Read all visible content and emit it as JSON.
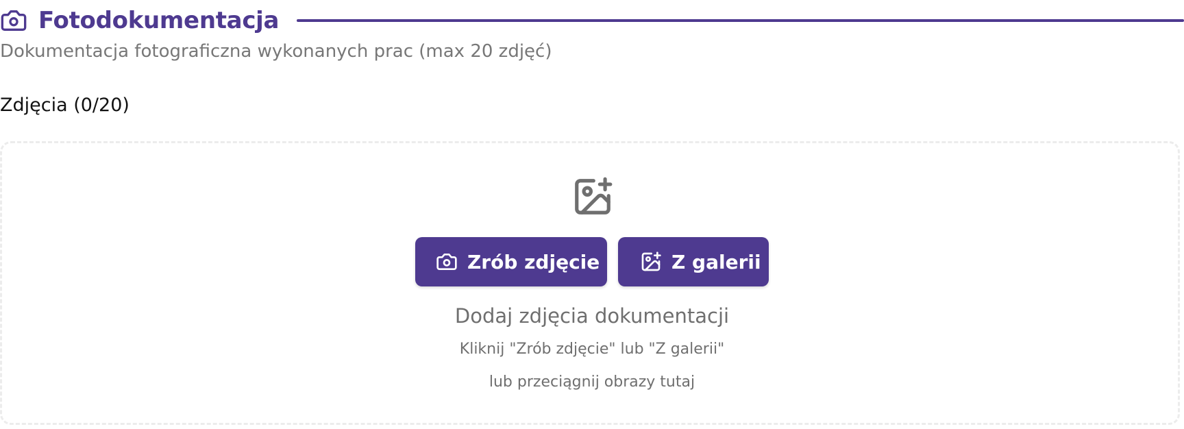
{
  "section": {
    "title": "Fotodokumentacja",
    "icon": "camera-icon",
    "accent_color": "#4e3a90",
    "subtitle": "Dokumentacja fotograficzna wykonanych prac (max 20 zdjęć)"
  },
  "photos": {
    "count_label": "Zdjęcia (0/20)",
    "count": 0,
    "max": 20
  },
  "dropzone": {
    "icon": "add-image-icon",
    "buttons": {
      "camera": {
        "label": "Zrób zdjęcie",
        "icon": "camera-icon"
      },
      "gallery": {
        "label": "Z galerii",
        "icon": "add-image-icon"
      }
    },
    "title": "Dodaj zdjęcia dokumentacji",
    "hint_line1": "Kliknij \"Zrób zdjęcie\" lub \"Z galerii\"",
    "hint_line2": "lub przeciągnij obrazy tutaj"
  }
}
